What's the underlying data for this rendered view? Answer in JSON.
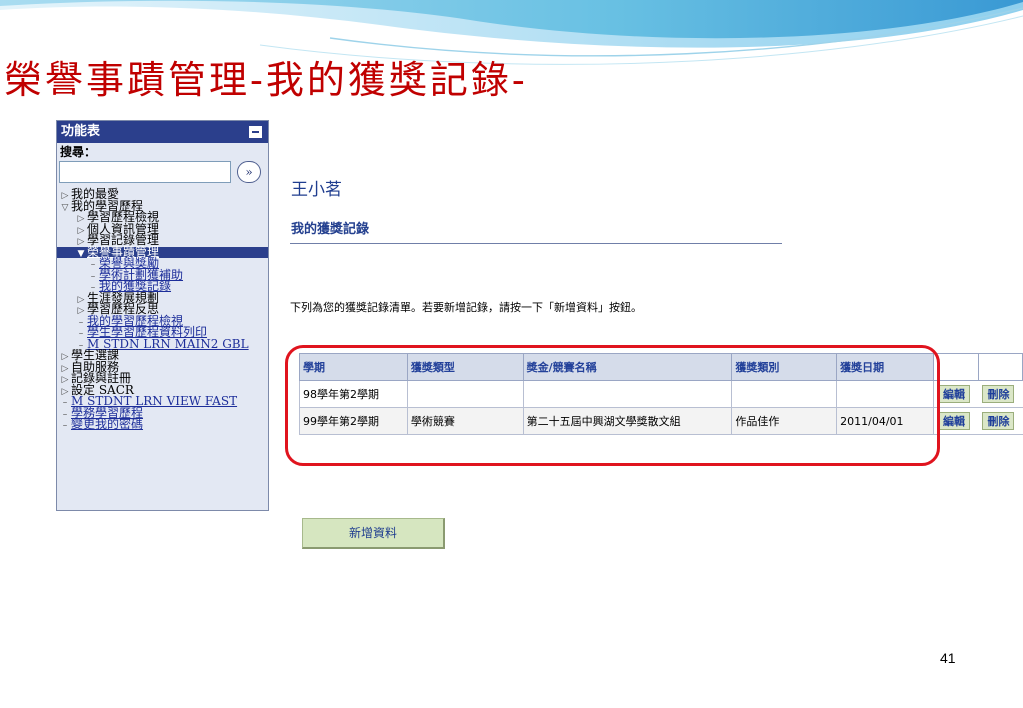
{
  "slide": {
    "title": "榮譽事蹟管理-我的獲獎記錄-",
    "page_number": "41"
  },
  "menu": {
    "title": "功能表",
    "search_label": "搜尋：",
    "search_value": "",
    "search_go": "»",
    "items": [
      {
        "label": "我的最愛",
        "marker": "▷",
        "link": false
      },
      {
        "label": "我的學習歷程",
        "marker": "▽",
        "link": false
      },
      {
        "label": "學習歷程檢視",
        "marker": "▷",
        "link": false
      },
      {
        "label": "個人資訊管理",
        "marker": "▷",
        "link": false
      },
      {
        "label": "學習記錄管理",
        "marker": "▷",
        "link": false
      },
      {
        "label": "榮譽事蹟管理",
        "marker": "▼",
        "link": true
      },
      {
        "label": "榮譽與獎勵",
        "marker": "–",
        "link": true
      },
      {
        "label": "學術計劃獲補助",
        "marker": "–",
        "link": true
      },
      {
        "label": "我的獲獎記錄",
        "marker": "–",
        "link": true
      },
      {
        "label": "生涯發展規劃",
        "marker": "▷",
        "link": false
      },
      {
        "label": "學習歷程反思",
        "marker": "▷",
        "link": false
      },
      {
        "label": "我的學習歷程檢視",
        "marker": "–",
        "link": true
      },
      {
        "label": "學生學習歷程資料列印",
        "marker": "–",
        "link": true
      },
      {
        "label": "M STDN LRN MAIN2 GBL",
        "marker": "–",
        "link": true
      },
      {
        "label": "學生選課",
        "marker": "▷",
        "link": false
      },
      {
        "label": "自助服務",
        "marker": "▷",
        "link": false
      },
      {
        "label": "記錄與註冊",
        "marker": "▷",
        "link": false
      },
      {
        "label": "設定 SACR",
        "marker": "▷",
        "link": false
      },
      {
        "label": "M STDNT LRN VIEW FAST",
        "marker": "–",
        "link": true
      },
      {
        "label": "學務學習歷程",
        "marker": "–",
        "link": true
      },
      {
        "label": "變更我的密碼",
        "marker": "–",
        "link": true
      }
    ]
  },
  "main": {
    "student_name": "王小茗",
    "section_title": "我的獲獎記錄",
    "instruction": "下列為您的獲獎記錄清單。若要新增記錄，請按一下「新增資料」按鈕。",
    "table": {
      "headers": [
        "學期",
        "獲獎類型",
        "獎金/競賽名稱",
        "獲獎類別",
        "獲獎日期"
      ],
      "rows": [
        {
          "cells": [
            "98學年第2學期",
            "",
            "",
            "",
            ""
          ],
          "edit": "編輯",
          "delete": "刪除"
        },
        {
          "cells": [
            "99學年第2學期",
            "學術競賽",
            "第二十五屆中興湖文學獎散文組",
            "作品佳作",
            "2011/04/01"
          ],
          "edit": "編輯",
          "delete": "刪除"
        }
      ]
    },
    "add_button": "新增資料"
  },
  "colors": {
    "title_red": "#c00000",
    "menu_header": "#2b3f8c",
    "highlight_ring": "#e0141e",
    "button_green": "#d6e6c0"
  }
}
